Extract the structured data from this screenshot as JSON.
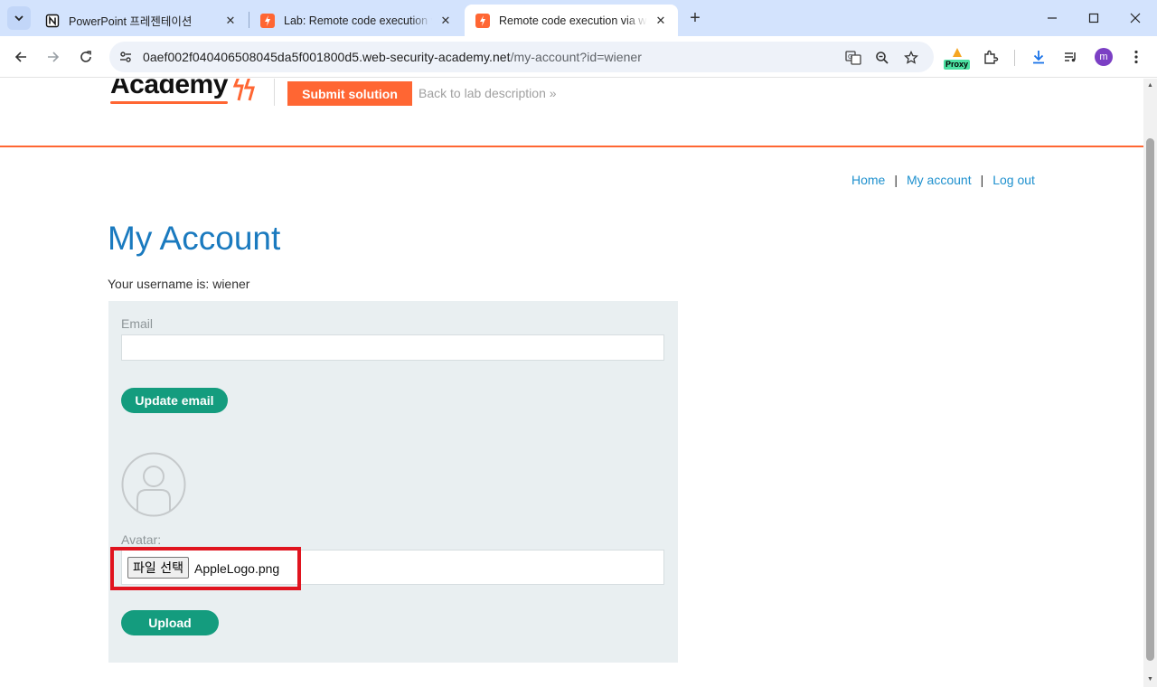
{
  "browser": {
    "tabs": [
      {
        "title": "PowerPoint 프레젠테이션",
        "favicon": "notion-icon",
        "active": false
      },
      {
        "title": "Lab: Remote code execution via web shell upload",
        "favicon": "portswigger-icon",
        "active": false
      },
      {
        "title": "Remote code execution via web shell upload",
        "favicon": "portswigger-icon",
        "active": true
      }
    ],
    "url_host": "0aef002f040406508045da5f001800d5.web-security-academy.net",
    "url_path": "/my-account?id=wiener",
    "profile_initial": "m",
    "proxy_label": "Proxy"
  },
  "lab_header": {
    "logo_text": "Academy",
    "submit_label": "Submit solution",
    "back_label": "Back to lab description",
    "back_chevron": "»",
    "accent_color": "#ff6633"
  },
  "nav": {
    "home": "Home",
    "separator": "|",
    "my_account": "My account",
    "log_out": "Log out"
  },
  "page": {
    "title": "My Account",
    "username_line": "Your username is: wiener"
  },
  "form": {
    "email_label": "Email",
    "email_value": "",
    "update_email_label": "Update email",
    "avatar_label": "Avatar:",
    "file_button_label": "파일 선택",
    "file_name": "AppleLogo.png",
    "upload_label": "Upload",
    "button_color": "#149c7e"
  },
  "annotation": {
    "highlight_color": "#e0141f"
  }
}
